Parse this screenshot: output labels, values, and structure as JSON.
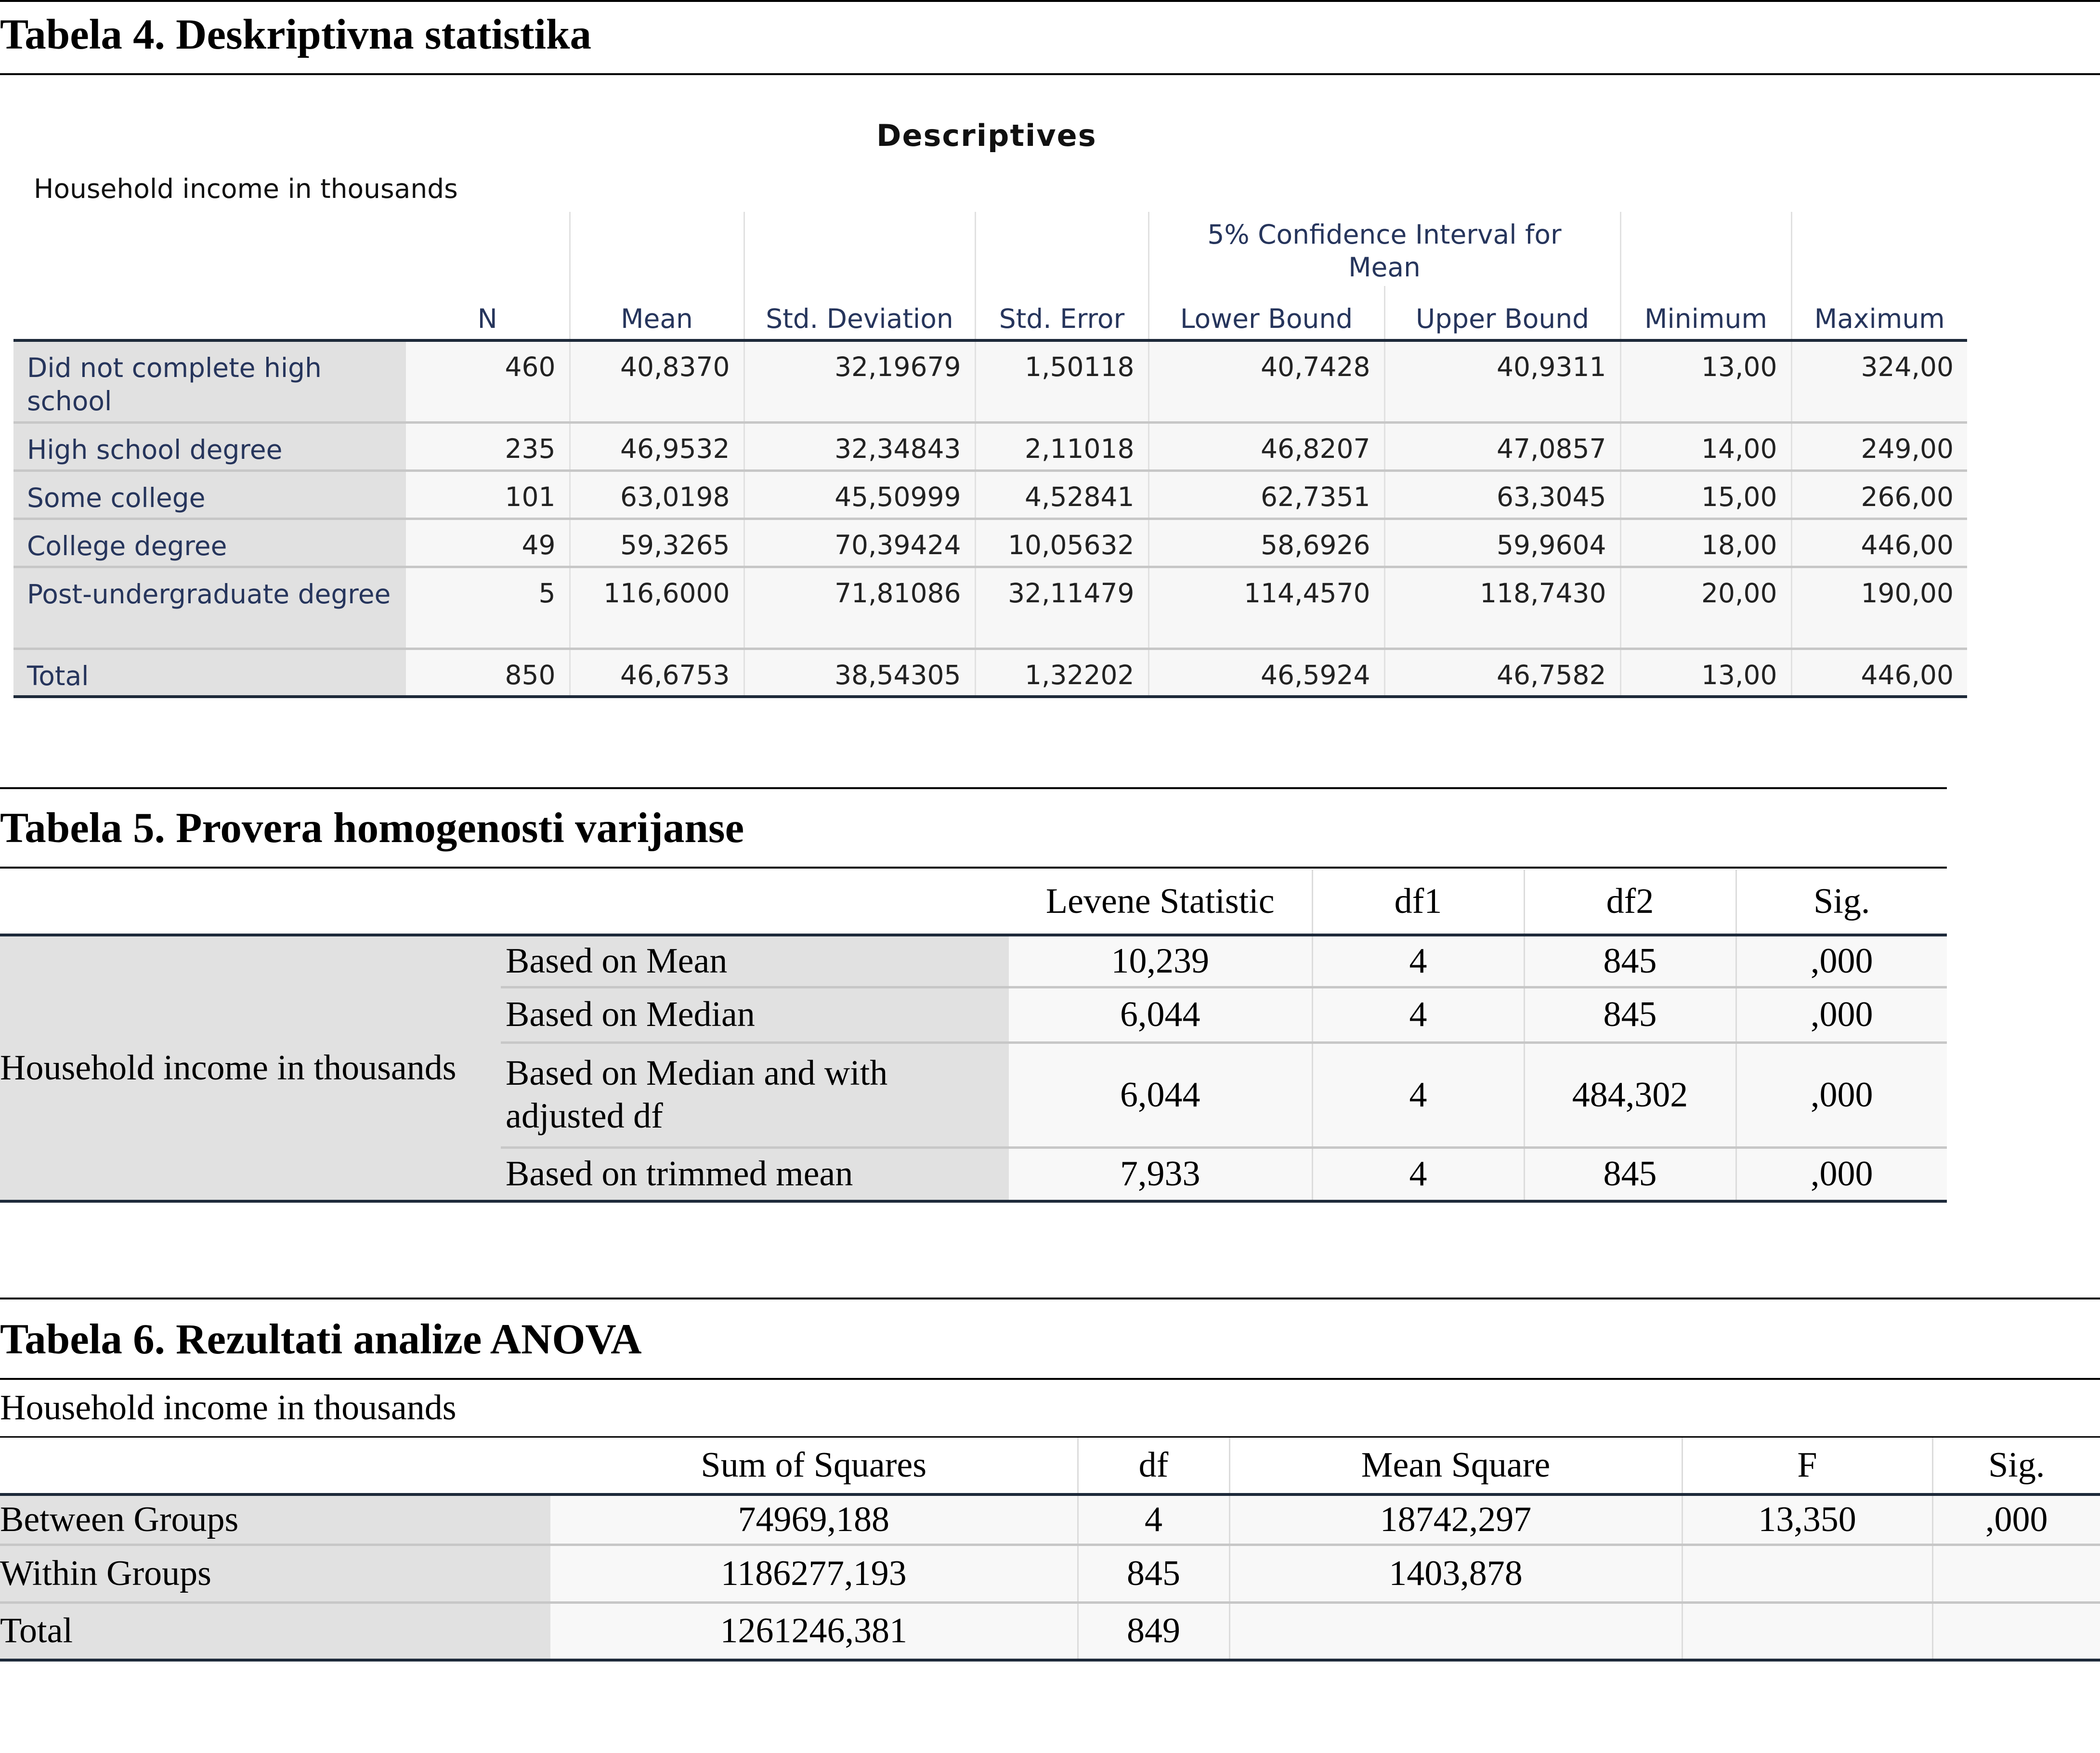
{
  "table4": {
    "caption": "Tabela 4. Deskriptivna statistika",
    "title": "Descriptives",
    "subtitle": "Household income in thousands",
    "ci_group": "5% Confidence Interval for Mean",
    "columns": [
      "N",
      "Mean",
      "Std. Deviation",
      "Std. Error",
      "Lower Bound",
      "Upper Bound",
      "Minimum",
      "Maximum"
    ],
    "rows": [
      {
        "label": "Did not complete high school",
        "values": [
          "460",
          "40,8370",
          "32,19679",
          "1,50118",
          "40,7428",
          "40,9311",
          "13,00",
          "324,00"
        ]
      },
      {
        "label": "High school degree",
        "values": [
          "235",
          "46,9532",
          "32,34843",
          "2,11018",
          "46,8207",
          "47,0857",
          "14,00",
          "249,00"
        ]
      },
      {
        "label": "Some college",
        "values": [
          "101",
          "63,0198",
          "45,50999",
          "4,52841",
          "62,7351",
          "63,3045",
          "15,00",
          "266,00"
        ]
      },
      {
        "label": "College degree",
        "values": [
          "49",
          "59,3265",
          "70,39424",
          "10,05632",
          "58,6926",
          "59,9604",
          "18,00",
          "446,00"
        ]
      },
      {
        "label": "Post-undergraduate degree",
        "values": [
          "5",
          "116,6000",
          "71,81086",
          "32,11479",
          "114,4570",
          "118,7430",
          "20,00",
          "190,00"
        ]
      },
      {
        "label": "Total",
        "values": [
          "850",
          "46,6753",
          "38,54305",
          "1,32202",
          "46,5924",
          "46,7582",
          "13,00",
          "446,00"
        ]
      }
    ]
  },
  "table5": {
    "caption": "Tabela 5. Provera homogenosti varijanse",
    "group_label": "Household income in thousands",
    "columns": [
      "Levene Statistic",
      "df1",
      "df2",
      "Sig."
    ],
    "rows": [
      {
        "label": "Based on Mean",
        "values": [
          "10,239",
          "4",
          "845",
          ",000"
        ]
      },
      {
        "label": "Based on Median",
        "values": [
          "6,044",
          "4",
          "845",
          ",000"
        ]
      },
      {
        "label": "Based on Median and with adjusted df",
        "values": [
          "6,044",
          "4",
          "484,302",
          ",000"
        ]
      },
      {
        "label": "Based on trimmed mean",
        "values": [
          "7,933",
          "4",
          "845",
          ",000"
        ]
      }
    ]
  },
  "table6": {
    "caption": "Tabela 6. Rezultati analize ANOVA",
    "subtitle": "Household income in thousands",
    "columns": [
      "Sum of Squares",
      "df",
      "Mean Square",
      "F",
      "Sig."
    ],
    "rows": [
      {
        "label": "Between Groups",
        "values": [
          "74969,188",
          "4",
          "18742,297",
          "13,350",
          ",000"
        ]
      },
      {
        "label": "Within Groups",
        "values": [
          "1186277,193",
          "845",
          "1403,878",
          "",
          ""
        ]
      },
      {
        "label": "Total",
        "values": [
          "1261246,381",
          "849",
          "",
          "",
          ""
        ]
      }
    ]
  }
}
